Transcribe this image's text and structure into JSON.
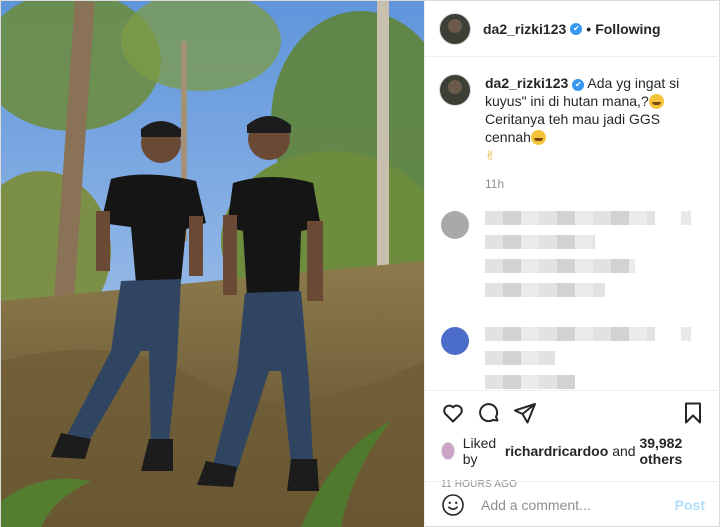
{
  "post": {
    "username": "da2_rizki123",
    "verified_glyph": "✔",
    "separator": "•",
    "follow_status": "Following",
    "caption_username": "da2_rizki123",
    "caption_line1": " Ada yg ingat si kuyus\" ini di hutan mana,?",
    "caption_line2": "Ceritanya teh mau jadi GGS cennah",
    "hand_glyph": "✌",
    "caption_time": "11h"
  },
  "actions": {
    "liked_prefix": "Liked by ",
    "liked_user": "richardricardoo",
    "liked_and": " and ",
    "liked_count": "39,982 others",
    "timestamp": "11 HOURS AGO"
  },
  "composer": {
    "placeholder": "Add a comment...",
    "post_label": "Post"
  },
  "icons": {
    "like": "heart-icon",
    "comment": "comment-icon",
    "share": "share-icon",
    "save": "bookmark-icon",
    "emoji": "smiley-icon"
  },
  "colors": {
    "accent": "#3897f0",
    "post_disabled": "#b2dffc",
    "muted": "#8e8e8e"
  }
}
